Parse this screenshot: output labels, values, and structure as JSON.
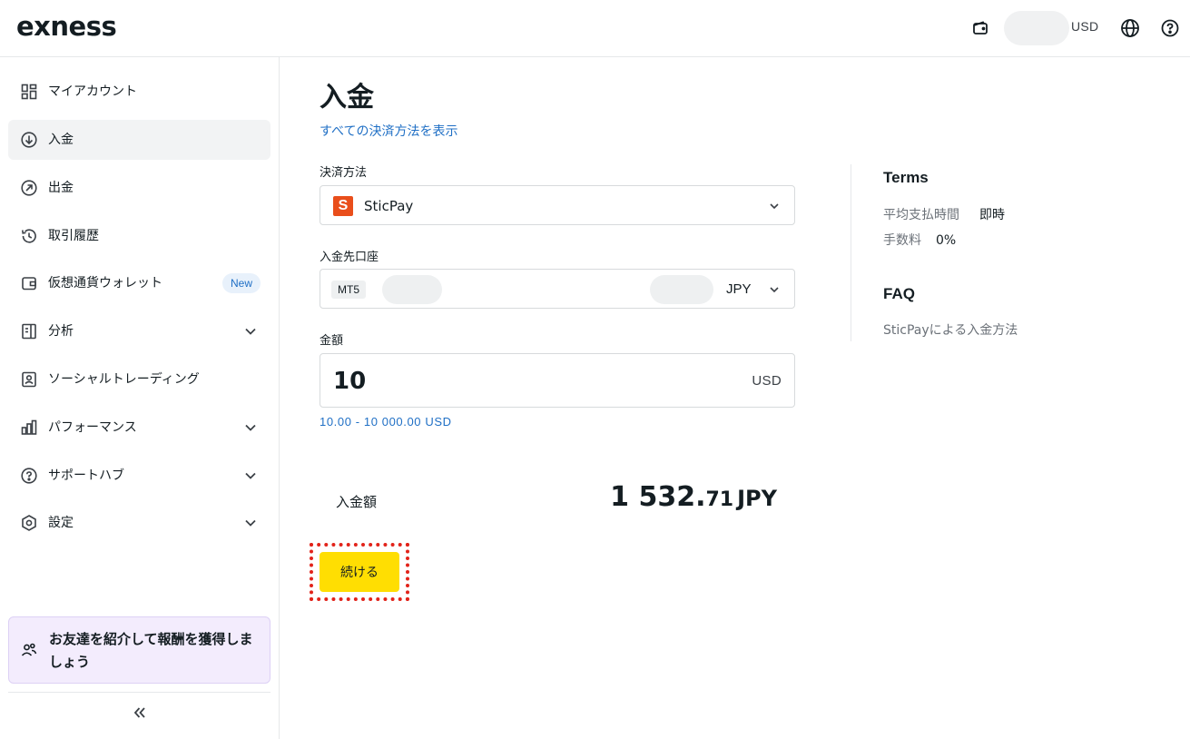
{
  "brand": {
    "logo_text": "exness",
    "accent_color": "#ffde02",
    "link_color": "#1f6fc5"
  },
  "header": {
    "currency": "USD",
    "icons": [
      "wallet-icon",
      "globe-icon",
      "help-icon"
    ]
  },
  "sidebar": {
    "items": [
      {
        "label": "マイアカウント",
        "icon": "dashboard-icon",
        "active": false
      },
      {
        "label": "入金",
        "icon": "arrow-down-circle-icon",
        "active": true
      },
      {
        "label": "出金",
        "icon": "arrow-up-right-circle-icon",
        "active": false
      },
      {
        "label": "取引履歴",
        "icon": "history-icon",
        "active": false
      },
      {
        "label": "仮想通貨ウォレット",
        "icon": "wallet-icon",
        "badge": "New",
        "active": false
      },
      {
        "label": "分析",
        "icon": "analytics-icon",
        "expandable": true,
        "active": false
      },
      {
        "label": "ソーシャルトレーディング",
        "icon": "social-trading-icon",
        "active": false
      },
      {
        "label": "パフォーマンス",
        "icon": "bar-chart-icon",
        "expandable": true,
        "active": false
      },
      {
        "label": "サポートハブ",
        "icon": "help-circle-icon",
        "expandable": true,
        "active": false
      },
      {
        "label": "設定",
        "icon": "settings-icon",
        "expandable": true,
        "active": false
      }
    ],
    "referral": "お友達を紹介して報酬を獲得しましょう"
  },
  "main": {
    "title": "入金",
    "all_methods_link": "すべての決済方法を表示",
    "payment_method": {
      "label": "決済方法",
      "value": "SticPay",
      "logo_letter": "S"
    },
    "account": {
      "label": "入金先口座",
      "type": "MT5",
      "currency": "JPY"
    },
    "amount": {
      "label": "金額",
      "value": "10",
      "currency": "USD",
      "range": "10.00 - 10 000.00 USD"
    },
    "total": {
      "label": "入金額",
      "major": "1 532.",
      "minor": "71",
      "currency": "JPY"
    },
    "continue_label": "続ける"
  },
  "info": {
    "terms_heading": "Terms",
    "rows": [
      {
        "key": "平均支払時間",
        "value": "即時"
      },
      {
        "key": "手数料",
        "value": "0%"
      }
    ],
    "faq_heading": "FAQ",
    "faq_link": "SticPayによる入金方法"
  }
}
